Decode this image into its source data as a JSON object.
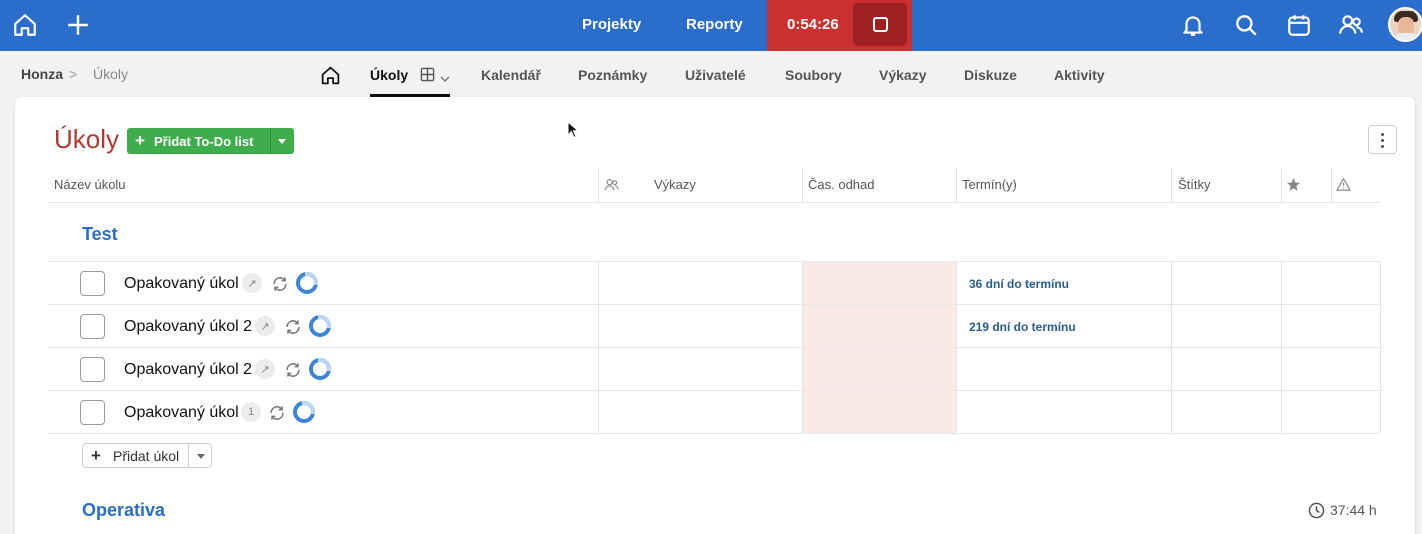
{
  "topbar": {
    "nav": [
      "Projekty",
      "Reporty"
    ],
    "timer": "0:54:26",
    "icons": [
      "home-icon",
      "plus-icon",
      "bell-icon",
      "search-icon",
      "calendar-icon",
      "users-icon"
    ]
  },
  "breadcrumb": {
    "parent": "Honza",
    "separator": ">",
    "current": "Úkoly"
  },
  "tabs": [
    {
      "label": "Úkoly",
      "active": true
    },
    {
      "label": "Kalendář"
    },
    {
      "label": "Poznámky"
    },
    {
      "label": "Uživatelé"
    },
    {
      "label": "Soubory"
    },
    {
      "label": "Výkazy"
    },
    {
      "label": "Diskuze"
    },
    {
      "label": "Aktivity"
    }
  ],
  "page": {
    "title": "Úkoly",
    "add_list_label": "Přidat To-Do list"
  },
  "columns": {
    "name": "Název úkolu",
    "reports": "Výkazy",
    "estimate": "Čas. odhad",
    "deadlines": "Termín(y)",
    "tags": "Štítky"
  },
  "sections": [
    {
      "title": "Test",
      "tasks": [
        {
          "name": "Opakovaný úkol",
          "badge": "↗",
          "deadline": "36 dní do termínu"
        },
        {
          "name": "Opakovaný úkol 2",
          "badge": "↗",
          "deadline": "219 dní do termínu"
        },
        {
          "name": "Opakovaný úkol 2",
          "badge": "↗",
          "deadline": ""
        },
        {
          "name": "Opakovaný úkol",
          "badge": "1",
          "deadline": ""
        }
      ],
      "add_task_label": "Přidat úkol"
    },
    {
      "title": "Operativa",
      "total_time": "37:44 h"
    }
  ],
  "colors": {
    "topbar": "#2b6dcb",
    "timer": "#c9302f",
    "title": "#b23a36",
    "add_button": "#3fad4c",
    "link": "#2b6dcb"
  }
}
